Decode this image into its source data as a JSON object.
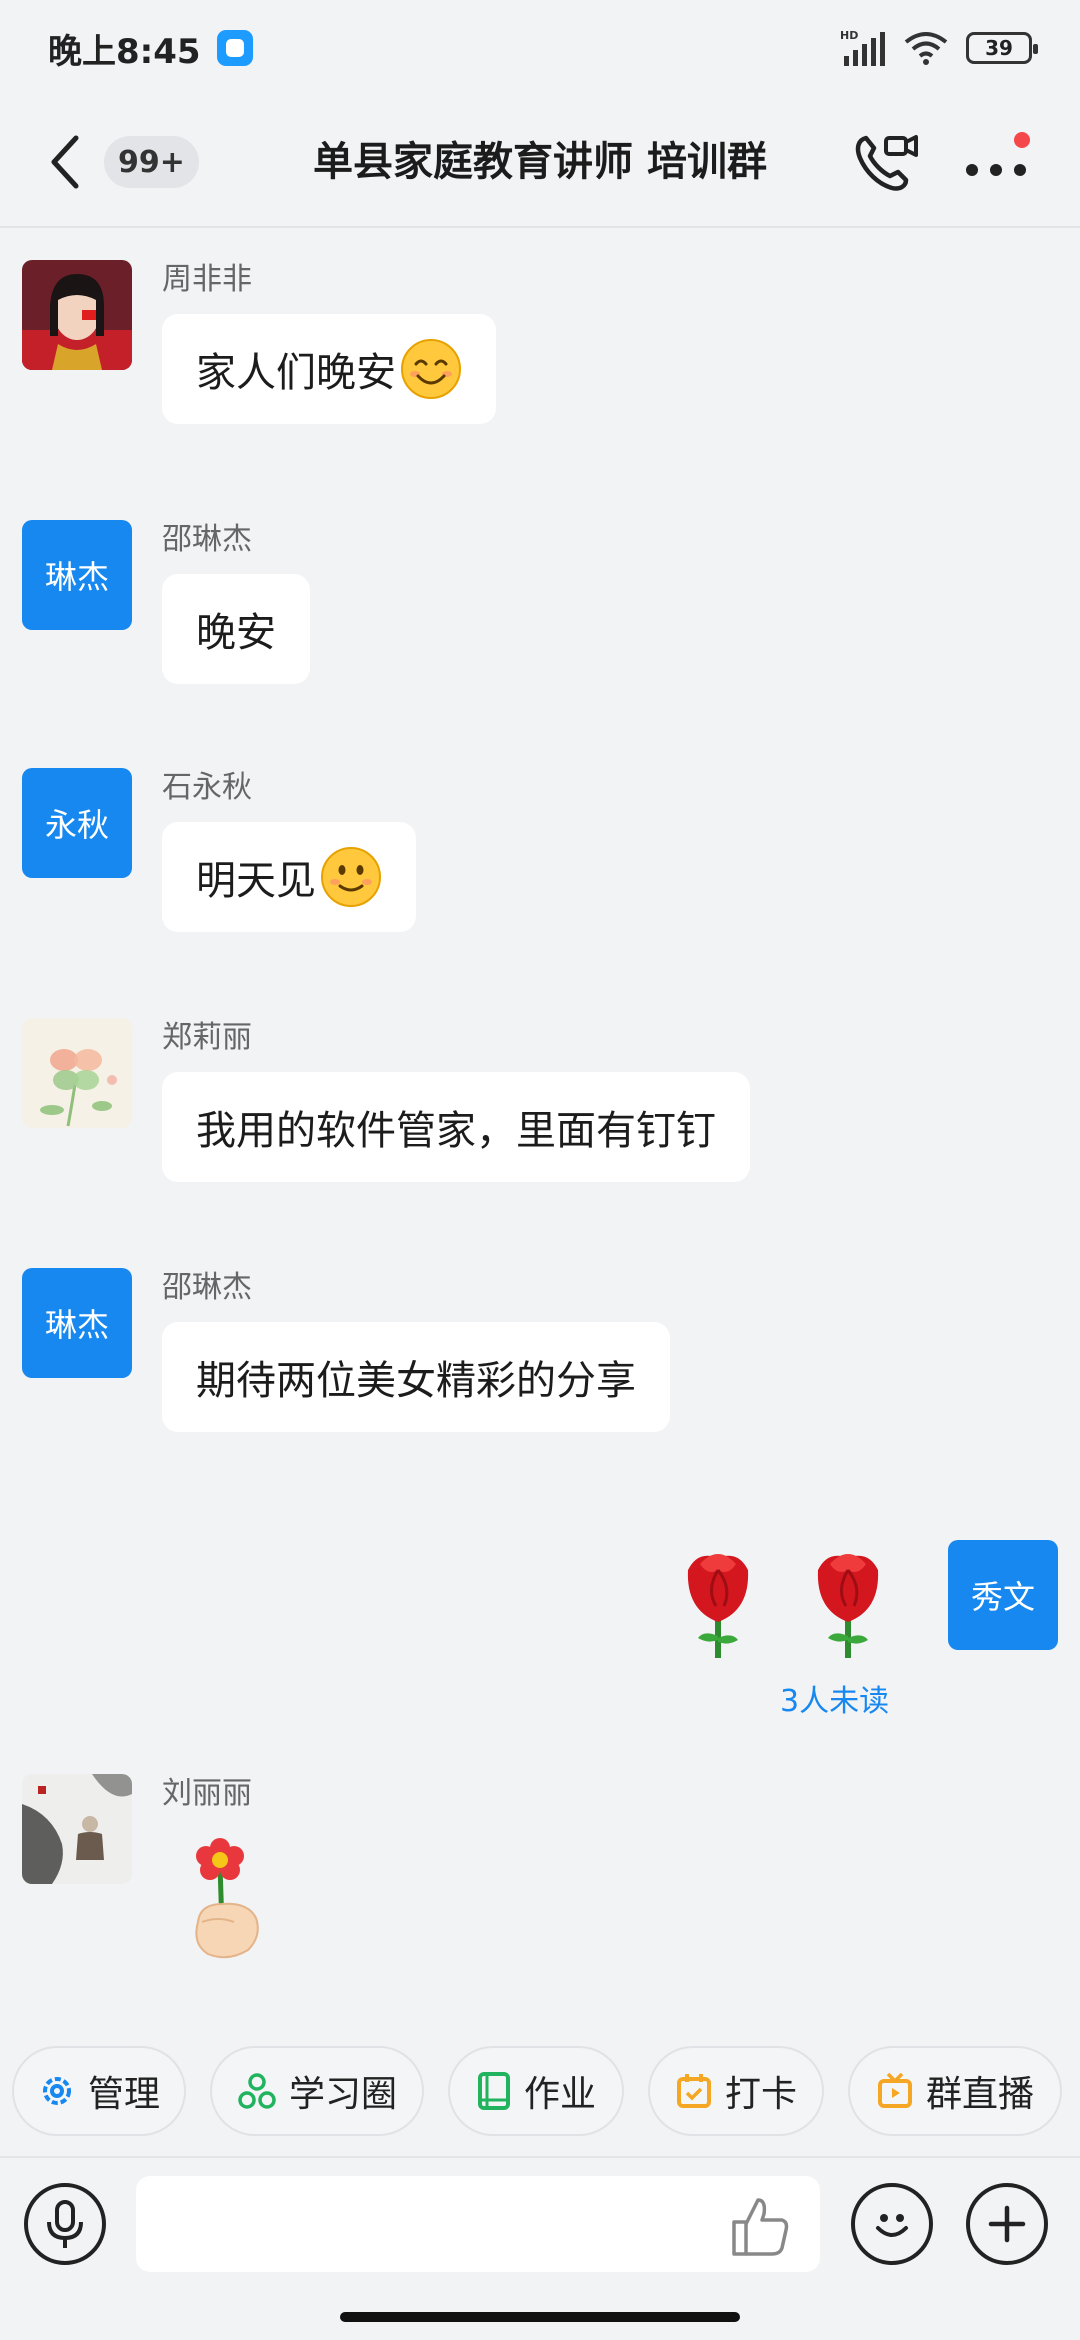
{
  "status_bar": {
    "time": "晚上8:45",
    "network_label": "HD",
    "battery": "39"
  },
  "header": {
    "back_icon": "chevron-left-icon",
    "unread_count": "99+",
    "title": "单县家庭教育讲师 培训群",
    "call_icon": "video-call-icon",
    "more_icon": "more-dots-icon",
    "accent": "#1688f0",
    "badge_color": "#f5484a"
  },
  "messages": [
    {
      "sender": "周非非",
      "avatar_type": "photo",
      "text": "家人们晚安",
      "emoji": "smiling-face-icon"
    },
    {
      "sender": "邵琳杰",
      "avatar_text": "琳杰",
      "text": "晚安"
    },
    {
      "sender": "石永秋",
      "avatar_text": "永秋",
      "text": "明天见",
      "emoji": "slight-smile-icon"
    },
    {
      "sender": "郑莉丽",
      "avatar_type": "flower-photo",
      "text": "我用的软件管家，里面有钉钉"
    },
    {
      "sender": "邵琳杰",
      "avatar_text": "琳杰",
      "text": "期待两位美女精彩的分享"
    },
    {
      "sender_self": true,
      "avatar_text": "秀文",
      "content": "rose-emoji x2",
      "read_status": "3人未读"
    },
    {
      "sender": "刘丽丽",
      "avatar_type": "ink-painting",
      "content": "hand-holding-flower-sticker"
    }
  ],
  "quick_actions": [
    {
      "label": "管理",
      "icon": "gear-icon",
      "color": "#1688f0"
    },
    {
      "label": "学习圈",
      "icon": "circles-icon",
      "color": "#22b35e"
    },
    {
      "label": "作业",
      "icon": "book-icon",
      "color": "#22b35e"
    },
    {
      "label": "打卡",
      "icon": "calendar-check-icon",
      "color": "#f5a623"
    },
    {
      "label": "群直播",
      "icon": "tv-play-icon",
      "color": "#f5a623"
    }
  ],
  "input_bar": {
    "voice_icon": "microphone-icon",
    "placeholder": "",
    "like_icon": "thumbs-up-icon",
    "emoji_icon": "emoji-face-icon",
    "plus_icon": "plus-icon"
  }
}
